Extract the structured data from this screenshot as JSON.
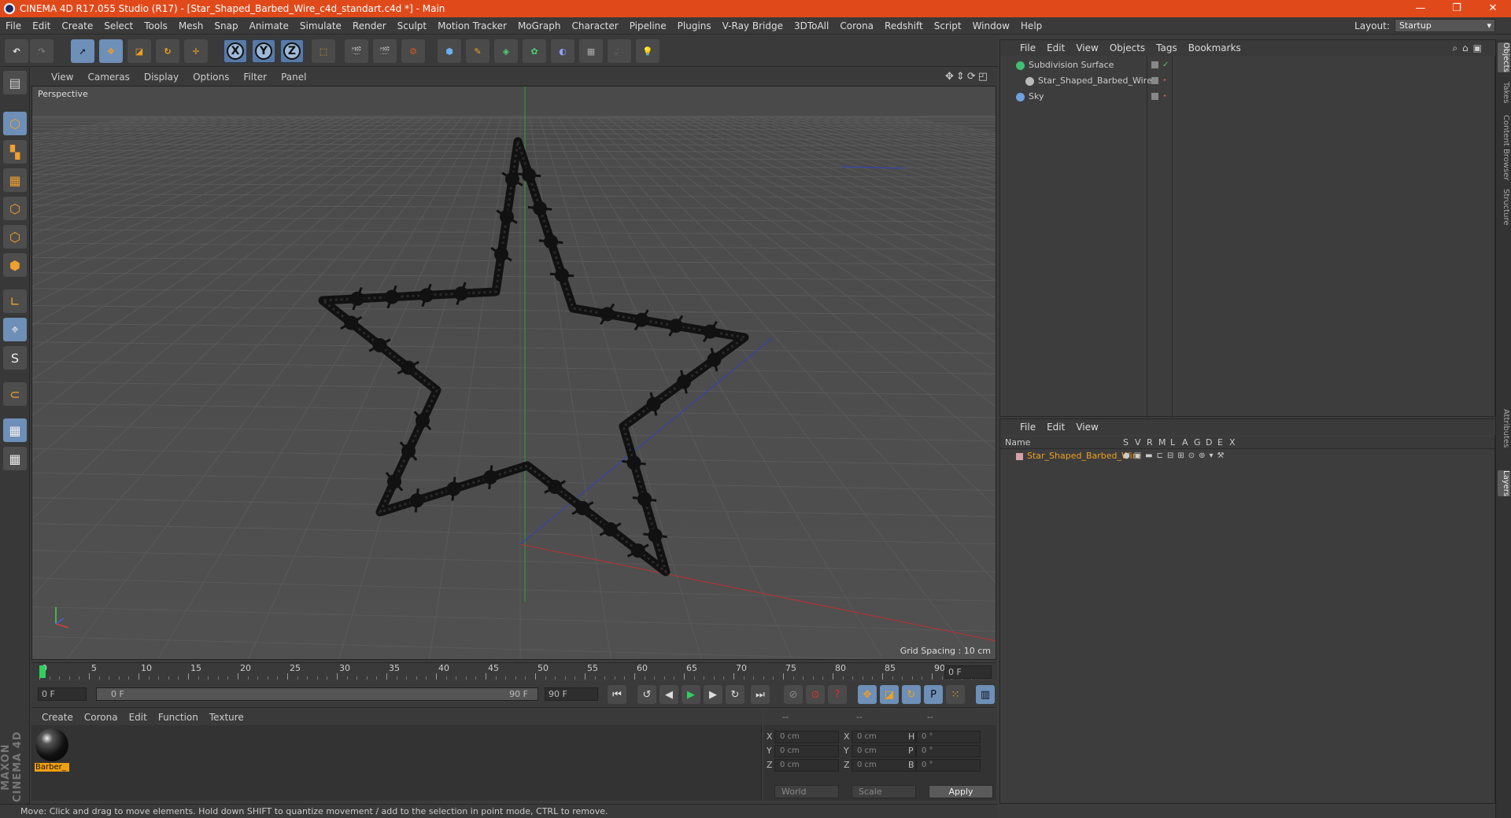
{
  "window": {
    "title": "CINEMA 4D R17.055 Studio (R17) - [Star_Shaped_Barbed_Wire_c4d_standart.c4d *] - Main",
    "controls": [
      "—",
      "❐",
      "✕"
    ]
  },
  "menu": {
    "items": [
      "File",
      "Edit",
      "Create",
      "Select",
      "Tools",
      "Mesh",
      "Snap",
      "Animate",
      "Simulate",
      "Render",
      "Sculpt",
      "Motion Tracker",
      "MoGraph",
      "Character",
      "Pipeline",
      "Plugins",
      "V-Ray Bridge",
      "3DToAll",
      "Corona",
      "Redshift",
      "Script",
      "Window",
      "Help"
    ],
    "layout_label": "Layout:",
    "layout_value": "Startup"
  },
  "toolbar": {
    "axis_x": "X",
    "axis_y": "Y",
    "axis_z": "Z"
  },
  "viewport": {
    "menu": [
      "View",
      "Cameras",
      "Display",
      "Options",
      "Filter",
      "Panel"
    ],
    "camera_label": "Perspective",
    "grid_spacing": "Grid Spacing : 10 cm"
  },
  "timeline": {
    "ticks": [
      "0",
      "5",
      "10",
      "15",
      "20",
      "25",
      "30",
      "35",
      "40",
      "45",
      "50",
      "55",
      "60",
      "65",
      "70",
      "75",
      "80",
      "85",
      "90"
    ],
    "current_frame_field": "0 F",
    "start_field": "0 F",
    "range_start": "0 F",
    "range_end": "90 F",
    "end_field": "90 F"
  },
  "material_manager": {
    "menu": [
      "Create",
      "Corona",
      "Edit",
      "Function",
      "Texture"
    ],
    "materials": [
      {
        "name": "Barber_"
      }
    ]
  },
  "coordinates": {
    "header": [
      "--",
      "--",
      "--"
    ],
    "rows": [
      {
        "a": "X",
        "av": "0 cm",
        "b": "X",
        "bv": "0 cm",
        "c": "H",
        "cv": "0 °"
      },
      {
        "a": "Y",
        "av": "0 cm",
        "b": "Y",
        "bv": "0 cm",
        "c": "P",
        "cv": "0 °"
      },
      {
        "a": "Z",
        "av": "0 cm",
        "b": "Z",
        "bv": "0 cm",
        "c": "B",
        "cv": "0 °"
      }
    ],
    "mode": "World",
    "transform": "Scale",
    "apply": "Apply"
  },
  "status": "Move: Click and drag to move elements. Hold down SHIFT to quantize movement / add to the selection in point mode, CTRL to remove.",
  "objects": {
    "menu": [
      "File",
      "Edit",
      "View",
      "Objects",
      "Tags",
      "Bookmarks"
    ],
    "items": [
      {
        "name": "Subdivision Surface",
        "icon_color": "#3fbf6f",
        "indent": 0
      },
      {
        "name": "Star_Shaped_Barbed_Wire",
        "icon_color": "#bbbbbb",
        "indent": 1
      },
      {
        "name": "Sky",
        "icon_color": "#6fa0e0",
        "indent": 0
      }
    ]
  },
  "layers": {
    "menu": [
      "File",
      "Edit",
      "View"
    ],
    "header": {
      "name": "Name",
      "cols": [
        "S",
        "V",
        "R",
        "M",
        "L",
        "A",
        "G",
        "D",
        "E",
        "X"
      ]
    },
    "rows": [
      {
        "name": "Star_Shaped_Barbed_Wire",
        "color": "#d8a0a8"
      }
    ]
  },
  "side_tabs": [
    "Objects",
    "Takes",
    "Content Browser",
    "Structure",
    "Attributes",
    "Layers"
  ],
  "maxon": "MAXON CINEMA 4D"
}
